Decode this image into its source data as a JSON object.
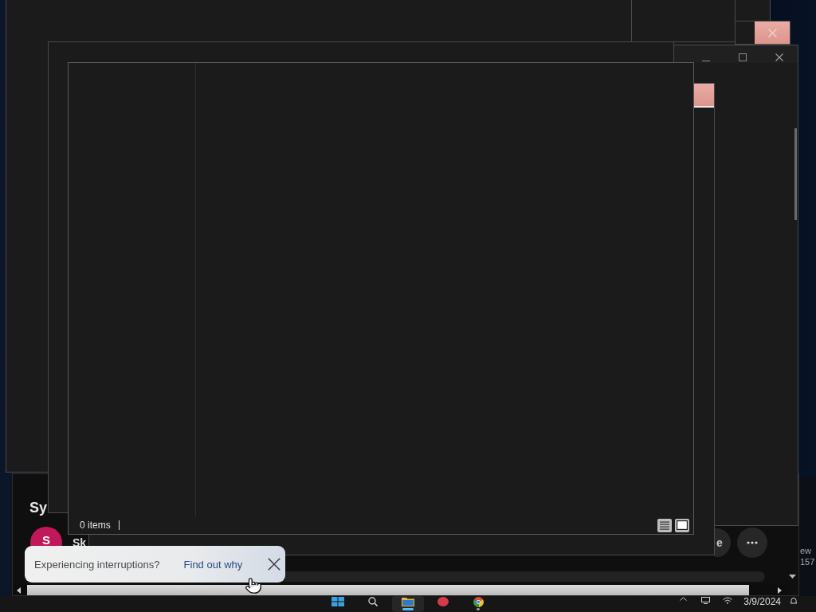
{
  "browser": {
    "heading": "Sy",
    "avatar": "S",
    "channel": "Sk",
    "actions": [
      {
        "kind": "pill",
        "label": "e"
      },
      {
        "kind": "more"
      }
    ]
  },
  "side_window": {
    "lines": [
      "ew",
      "157"
    ]
  },
  "explorer": {
    "status_bar": {
      "item_count": "0 items"
    }
  },
  "notification": {
    "message": "Experiencing interruptions?",
    "link": "Find out why"
  },
  "taskbar": {
    "apps": [
      {
        "kind": "start",
        "selected": false,
        "running": false
      },
      {
        "kind": "search",
        "selected": false,
        "running": false
      },
      {
        "kind": "folder",
        "selected": true,
        "running": true
      },
      {
        "kind": "circle",
        "selected": false,
        "running": false
      },
      {
        "kind": "browser",
        "selected": false,
        "running": true
      }
    ],
    "date": "3/9/2024"
  }
}
